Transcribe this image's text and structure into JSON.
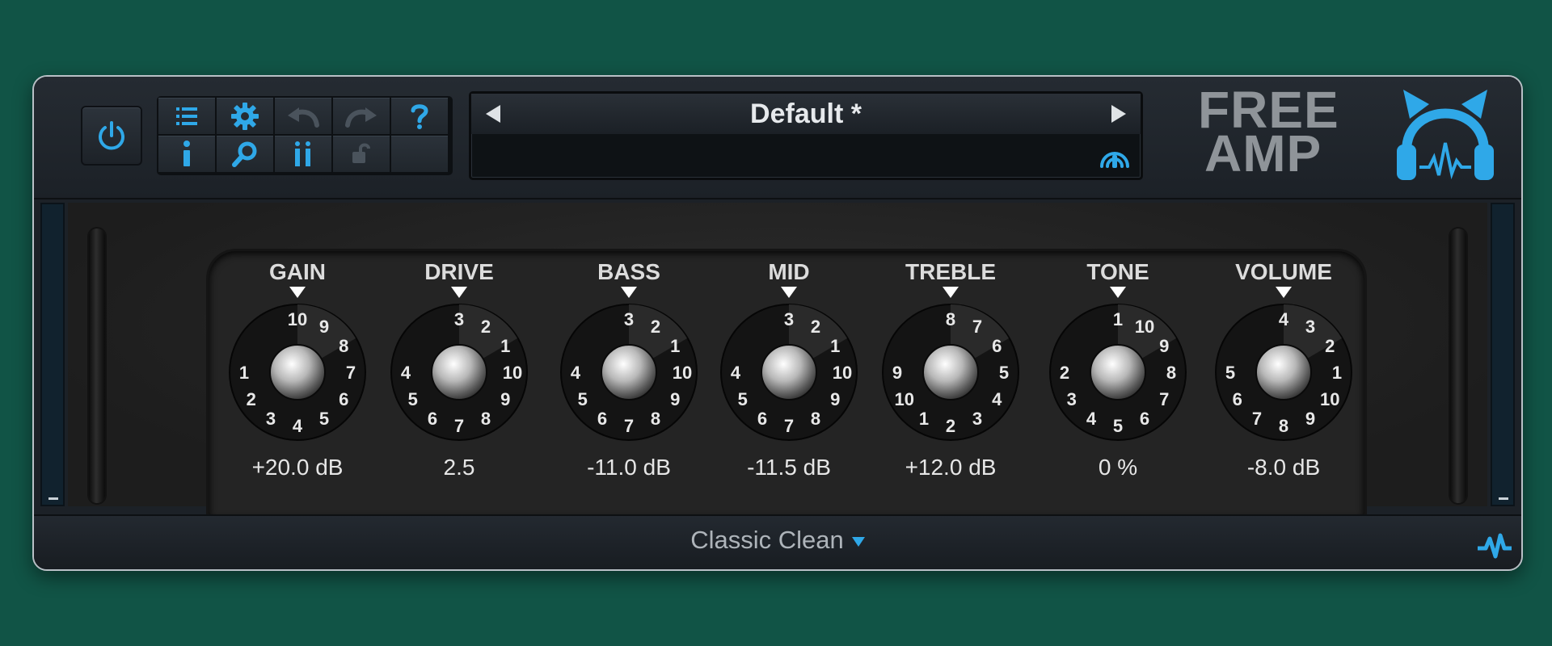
{
  "plugin": {
    "logo_line1": "FREE",
    "logo_line2": "AMP",
    "preset_name": "Default *",
    "amp_model": "Classic Clean"
  },
  "toolbar": {
    "icons": [
      "menu-icon",
      "settings-gear-icon",
      "undo-icon",
      "redo-icon",
      "help-icon",
      "info-icon",
      "search-icon",
      "meter-icon",
      "lock-icon",
      "empty-slot"
    ]
  },
  "knobs": [
    {
      "label": "GAIN",
      "value": "+20.0 dB",
      "scale": [
        "10",
        "9",
        "8",
        "7",
        "6",
        "5",
        "4",
        "3",
        "2",
        "1"
      ]
    },
    {
      "label": "DRIVE",
      "value": "2.5",
      "scale": [
        "3",
        "2",
        "1",
        "10",
        "9",
        "8",
        "7",
        "6",
        "5",
        "4"
      ]
    },
    {
      "label": "BASS",
      "value": "-11.0 dB",
      "scale": [
        "3",
        "2",
        "1",
        "10",
        "9",
        "8",
        "7",
        "6",
        "5",
        "4"
      ]
    },
    {
      "label": "MID",
      "value": "-11.5 dB",
      "scale": [
        "3",
        "2",
        "1",
        "10",
        "9",
        "8",
        "7",
        "6",
        "5",
        "4"
      ]
    },
    {
      "label": "TREBLE",
      "value": "+12.0 dB",
      "scale": [
        "8",
        "7",
        "6",
        "5",
        "4",
        "3",
        "2",
        "1",
        "10",
        "9"
      ]
    },
    {
      "label": "TONE",
      "value": "0 %",
      "scale": [
        "1",
        "10",
        "9",
        "8",
        "7",
        "6",
        "5",
        "4",
        "3",
        "2"
      ]
    },
    {
      "label": "VOLUME",
      "value": "-8.0 dB",
      "scale": [
        "4",
        "3",
        "2",
        "1",
        "10",
        "9",
        "8",
        "7",
        "6",
        "5"
      ]
    }
  ],
  "colors": {
    "accent": "#2fa8e8",
    "background": "#115446",
    "panel": "#1c2127"
  }
}
